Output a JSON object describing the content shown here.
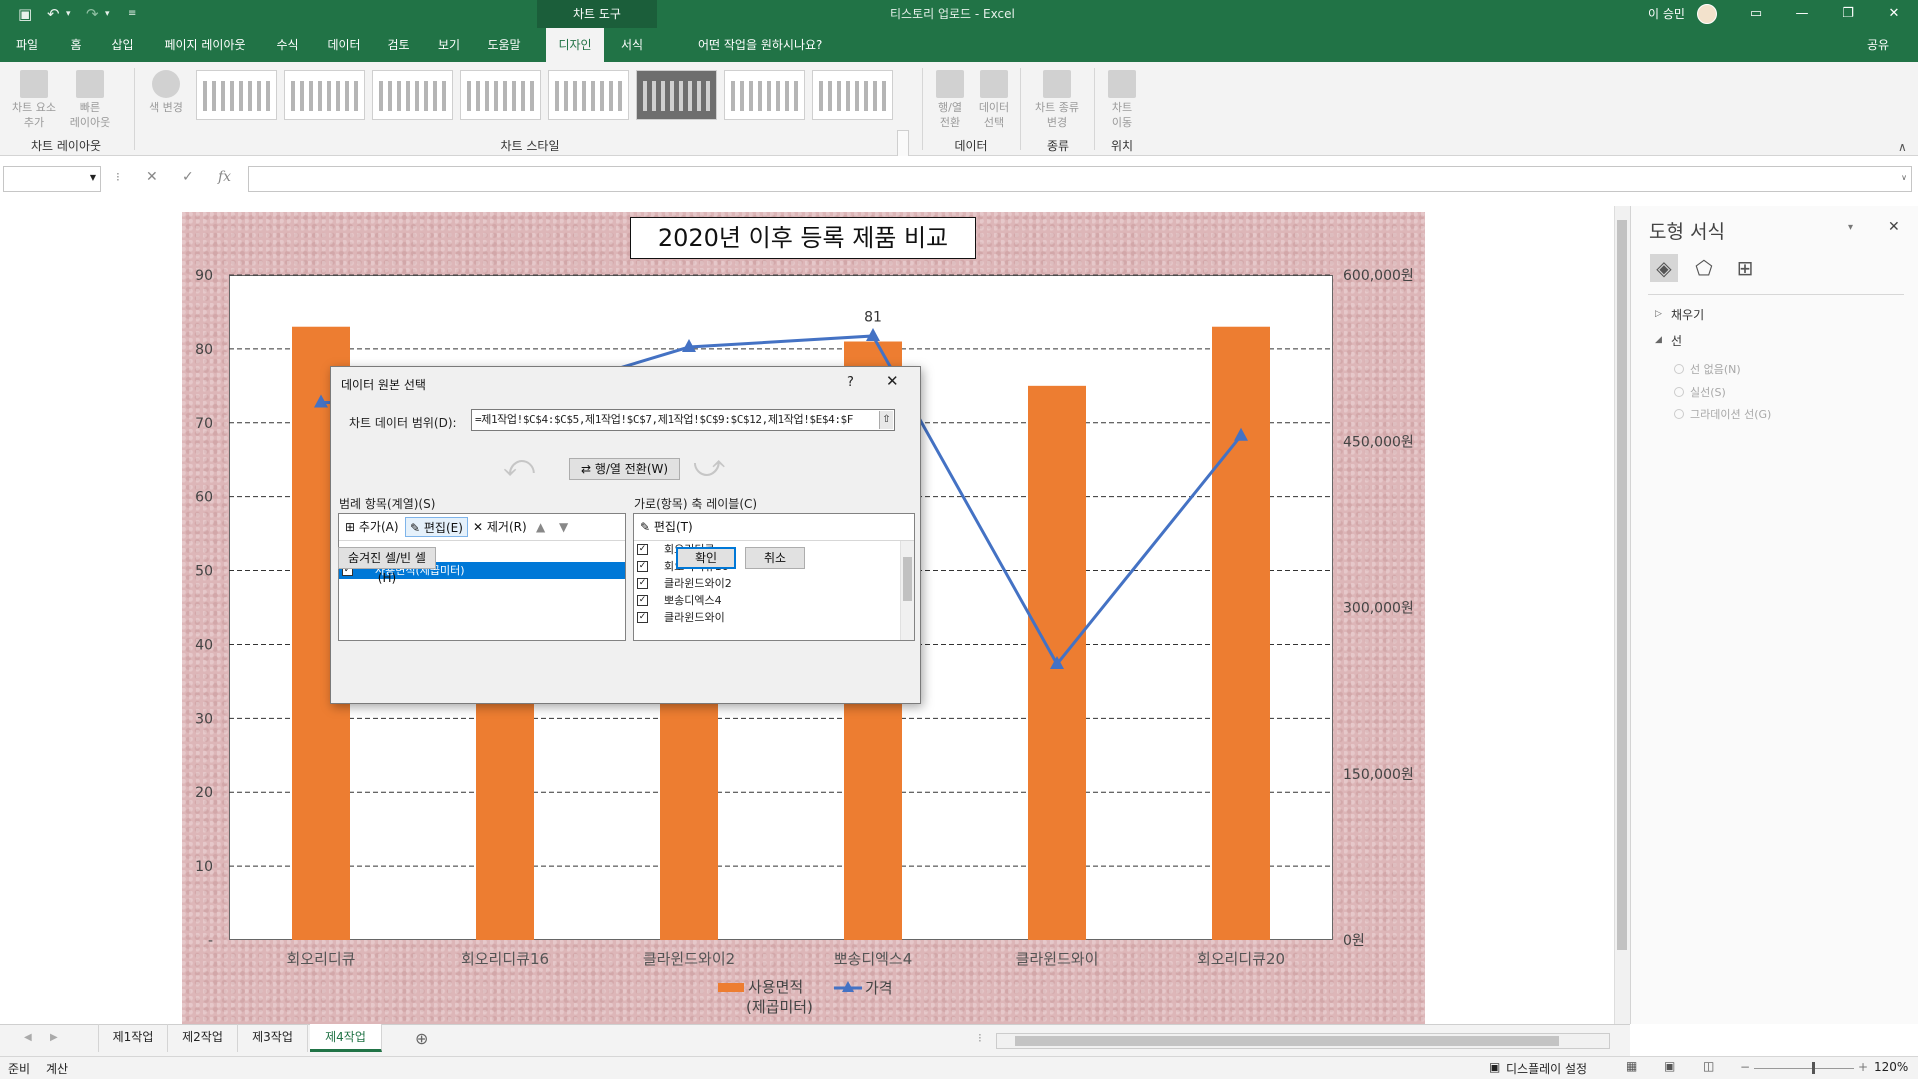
{
  "app": {
    "window_title": "티스토리 업로드  -  Excel",
    "contextual_tab_group": "차트 도구",
    "user": "이 승민",
    "tell_me": "어떤 작업을 원하시나요?",
    "share": "공유"
  },
  "ribbon_tabs": [
    "파일",
    "홈",
    "삽입",
    "페이지 레이아웃",
    "수식",
    "데이터",
    "검토",
    "보기",
    "도움말",
    "디자인",
    "서식"
  ],
  "active_tab": "디자인",
  "ribbon": {
    "add_element": "차트 요소\n추가",
    "quick_layout": "빠른\n레이아웃",
    "change_colors": "색 변경",
    "switch_row_col": "행/열\n전환",
    "select_data": "데이터\n선택",
    "change_type": "차트 종류\n변경",
    "move_chart": "차트\n이동",
    "group_layouts": "차트 레이아웃",
    "group_styles": "차트 스타일",
    "group_data": "데이터",
    "group_type": "종류",
    "group_location": "위치"
  },
  "formula_bar": {
    "fx": "fx"
  },
  "chart_data": {
    "type": "bar",
    "title": "2020년 이후 등록 제품 비교",
    "categories": [
      "회오리디큐",
      "회오리디큐16",
      "클라윈드와이2",
      "뽀송디엑스4",
      "클라윈드와이",
      "회오리디큐20"
    ],
    "series": [
      {
        "name": "사용면적\n(제곱미터)",
        "type": "bar",
        "axis": "left",
        "color": "#ed7d31",
        "values": [
          83,
          46,
          53,
          81,
          75,
          83
        ]
      },
      {
        "name": "가격",
        "type": "line",
        "axis": "right",
        "color": "#4472c4",
        "values": [
          485000,
          485000,
          535000,
          545000,
          249000,
          455000
        ]
      }
    ],
    "y_left": {
      "min": 0,
      "max": 90,
      "ticks": [
        "-",
        "10",
        "20",
        "30",
        "40",
        "50",
        "60",
        "70",
        "80",
        "90"
      ]
    },
    "y_right": {
      "min": 0,
      "max": 600000,
      "ticks": [
        "0원",
        "150,000원",
        "300,000원",
        "450,000원",
        "600,000원"
      ]
    },
    "data_label": "81",
    "gridlines": "dashed",
    "legend_position": "bottom"
  },
  "dialog": {
    "title": "데이터 원본 선택",
    "help": "?",
    "close": "✕",
    "range_label": "차트 데이터 범위(D):",
    "range_value": "=제1작업!$C$4:$C$5,제1작업!$C$7,제1작업!$C$9:$C$12,제1작업!$E$4:$F",
    "switch": "행/열 전환(W)",
    "legend_label": "범례 항목(계열)(S)",
    "axis_label": "가로(항목) 축 레이블(C)",
    "add": "추가(A)",
    "edit": "편집(E)",
    "remove": "제거(R)",
    "edit_axis": "편집(T)",
    "legend_items": [
      "가격",
      "사용면적(제곱미터)"
    ],
    "selected_legend_item": "사용면적(제곱미터)",
    "axis_items": [
      "회오리디큐",
      "회오리디큐16",
      "클라윈드와이2",
      "뽀송디엑스4",
      "클라윈드와이"
    ],
    "hidden_cells": "숨겨진 셀/빈 셀(H)",
    "ok": "확인",
    "cancel": "취소"
  },
  "format_pane": {
    "title": "도형 서식",
    "fill": "채우기",
    "line": "선",
    "no_line": "선 없음(N)",
    "solid_line": "실선(S)",
    "gradient_line": "그라데이션 선(G)"
  },
  "sheet_tabs": [
    "제1작업",
    "제2작업",
    "제3작업",
    "제4작업"
  ],
  "active_sheet": "제4작업",
  "status": {
    "ready": "준비",
    "calc": "계산",
    "display_settings": "디스플레이 설정",
    "zoom": "120%"
  }
}
